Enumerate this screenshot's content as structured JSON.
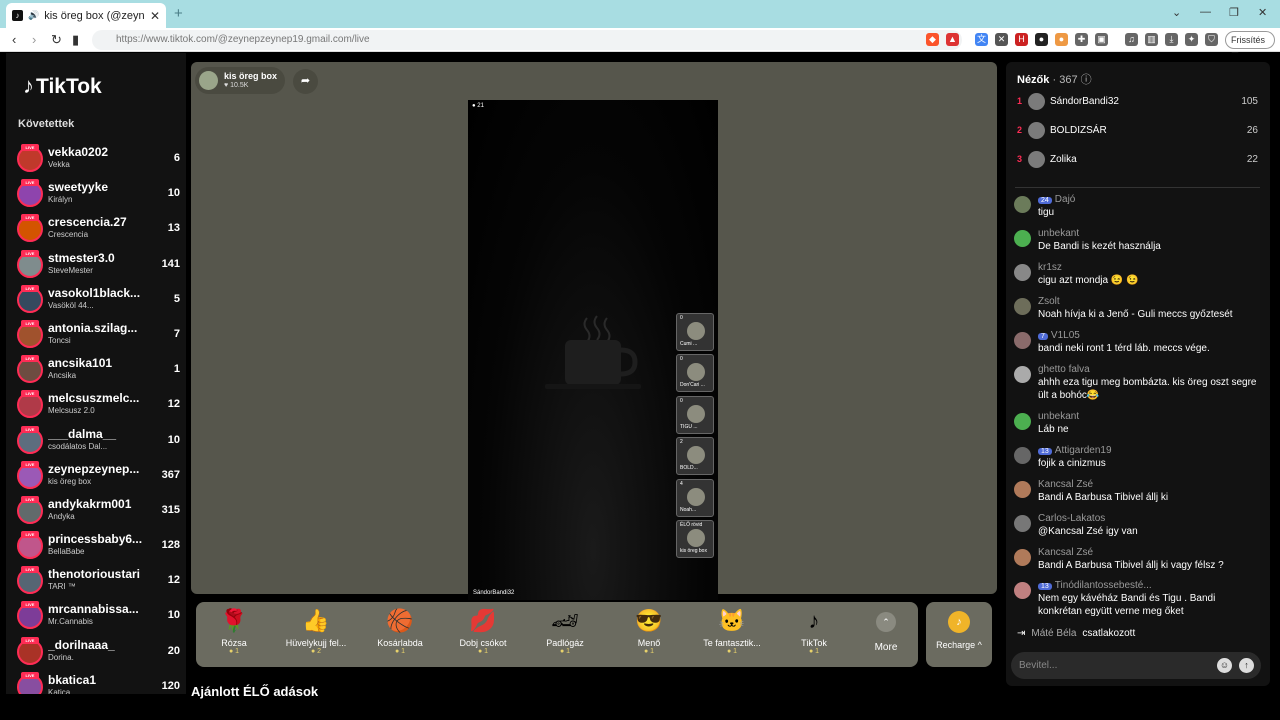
{
  "browser": {
    "tab_title": "kis öreg box (@zeynepzeyne",
    "url": "https://www.tiktok.com/@zeynepzeynep19.gmail.com/live",
    "update_label": "Frissítés"
  },
  "sidebar": {
    "logo": "TikTok",
    "following_title": "Követettek",
    "live_badge": "LIVE",
    "accounts": [
      {
        "name": "vekka0202",
        "sub": "Vekka",
        "count": "6"
      },
      {
        "name": "sweetyyke",
        "sub": "Királyn",
        "count": "10"
      },
      {
        "name": "crescencia.27",
        "sub": "Crescencia",
        "count": "13"
      },
      {
        "name": "stmester3.0",
        "sub": "SteveMester",
        "count": "141"
      },
      {
        "name": "vasokol1black...",
        "sub": "Vasököl 44...",
        "count": "5"
      },
      {
        "name": "antonia.szilag...",
        "sub": "Toncsi",
        "count": "7"
      },
      {
        "name": "ancsika101",
        "sub": "Ancsika",
        "count": "1"
      },
      {
        "name": "melcsuszmelc...",
        "sub": "Melcsusz 2.0",
        "count": "12"
      },
      {
        "name": "___dalma__",
        "sub": "csodálatos Dal...",
        "count": "10"
      },
      {
        "name": "zeynepzeynep...",
        "sub": "kis öreg box",
        "count": "367"
      },
      {
        "name": "andykakrm001",
        "sub": "Andyka",
        "count": "315"
      },
      {
        "name": "princessbaby6...",
        "sub": "BellaBabe",
        "count": "128"
      },
      {
        "name": "thenotorioustari",
        "sub": "TARI ™",
        "count": "12"
      },
      {
        "name": "mrcannabissa...",
        "sub": "Mr.Cannabis",
        "count": "10"
      },
      {
        "name": "_dorilnaaa_",
        "sub": "Dorina.",
        "count": "20"
      },
      {
        "name": "bkatica1",
        "sub": "Katica",
        "count": "120"
      }
    ]
  },
  "stream": {
    "host_name": "kis öreg box",
    "host_likes": "10.5K",
    "viewer_badge": "21",
    "host_tag": "SándorBandi32",
    "guests": [
      {
        "num": "0",
        "name": "Cumi ..."
      },
      {
        "num": "0",
        "name": "Don'Cari ..."
      },
      {
        "num": "0",
        "name": "TIGU ..."
      },
      {
        "num": "2",
        "name": "BOLD..."
      },
      {
        "num": "4",
        "name": "Noah..."
      },
      {
        "num": "ÉLŐ rövid",
        "name": "kis öreg box"
      }
    ]
  },
  "gifts": [
    {
      "name": "Rózsa",
      "price": "1",
      "icon": "🌹"
    },
    {
      "name": "Hüvelykujj fel...",
      "price": "2",
      "icon": "👍"
    },
    {
      "name": "Kosárlabda",
      "price": "1",
      "icon": "🏀"
    },
    {
      "name": "Dobj csókot",
      "price": "1",
      "icon": "💋"
    },
    {
      "name": "Padlógáz",
      "price": "1",
      "icon": "🏎"
    },
    {
      "name": "Menő",
      "price": "1",
      "icon": "😎"
    },
    {
      "name": "Te fantasztik...",
      "price": "1",
      "icon": "🐱"
    },
    {
      "name": "TikTok",
      "price": "1",
      "icon": "♪"
    }
  ],
  "more_label": "More",
  "recharge_label": "Recharge ^",
  "recommended_title": "Ajánlott ÉLŐ adások",
  "viewers": {
    "title": "Nézők",
    "count": "367",
    "top": [
      {
        "rank": "1",
        "name": "SándorBandi32",
        "score": "105"
      },
      {
        "rank": "2",
        "name": "BOLDIZSÁR",
        "score": "26"
      },
      {
        "rank": "3",
        "name": "Zolika",
        "score": "22"
      }
    ]
  },
  "chat": [
    {
      "user": "Dajó",
      "level": "24",
      "text": "tigu"
    },
    {
      "user": "unbekant",
      "level": "",
      "text": "De Bandi is kezét használja"
    },
    {
      "user": "kr1sz",
      "level": "",
      "text": "cigu azt mondja 😉 😉"
    },
    {
      "user": "Zsolt",
      "level": "",
      "text": "Noah hívja ki a Jenő - Guli meccs győztesét"
    },
    {
      "user": "V1L05",
      "level": "7",
      "text": "bandi neki ront 1 térd láb. meccs vége."
    },
    {
      "user": "ghetto falva",
      "level": "",
      "text": "ahhh eza tigu meg bombázta. kis öreg oszt segre ült a bohóc😂"
    },
    {
      "user": "unbekant",
      "level": "",
      "text": "Láb ne"
    },
    {
      "user": "Attigarden19",
      "level": "13",
      "text": "fojik a cinizmus"
    },
    {
      "user": "Kancsal Zsé",
      "level": "",
      "text": "Bandi A Barbusa Tibivel állj ki"
    },
    {
      "user": "Carlos-Lakatos",
      "level": "",
      "text": "@Kancsal Zsé igy van"
    },
    {
      "user": "Kancsal Zsé",
      "level": "",
      "text": "Bandi A Barbusa Tibivel állj ki vagy félsz ?"
    },
    {
      "user": "Tinódilantossebesté...",
      "level": "13",
      "text": "Nem egy kávéház Bandi és Tigu . Bandi konkrétan együtt verne meg őket"
    }
  ],
  "join": {
    "name": "Máté Béla",
    "text": "csatlakozott"
  },
  "input": {
    "placeholder": "Bevitel..."
  }
}
